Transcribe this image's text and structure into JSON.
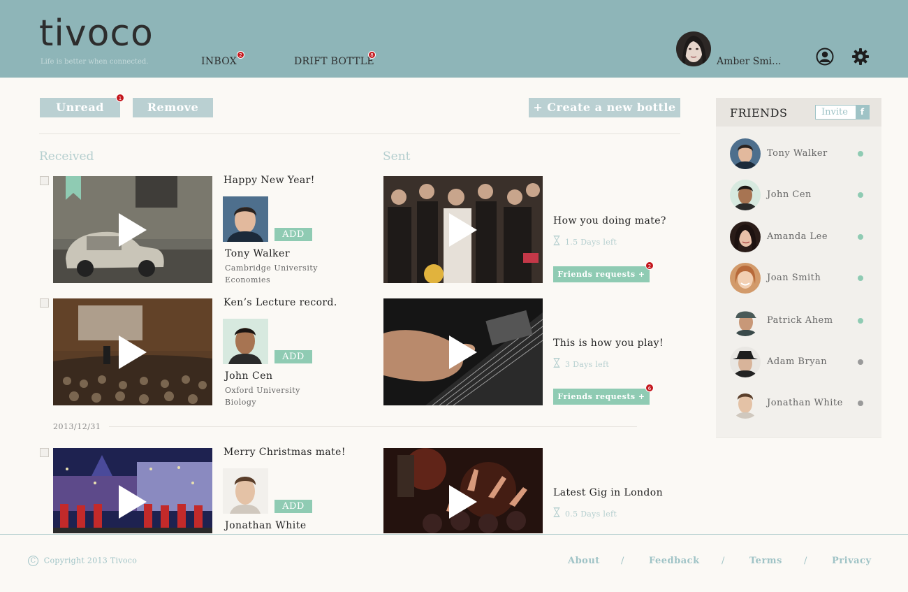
{
  "header": {
    "logo": "tivoco",
    "tagline": "Life is better when connected.",
    "nav": [
      {
        "label": "INBOX",
        "badge": "2"
      },
      {
        "label": "DRIFT BOTTLE",
        "badge": "8"
      }
    ],
    "user_name": "Amber Smi..."
  },
  "toolbar": {
    "unread_label": "Unread",
    "unread_badge": "1",
    "remove_label": "Remove",
    "create_label": "+ Create a new bottle"
  },
  "columns": {
    "received": "Received",
    "sent": "Sent"
  },
  "received": [
    {
      "title": "Happy New Year!",
      "name": "Tony Walker",
      "school": "Cambridge University",
      "major": "Economies",
      "add": "ADD"
    },
    {
      "title": "Ken’s Lecture record.",
      "name": "John Cen",
      "school": "Oxford University",
      "major": "Biology",
      "add": "ADD"
    },
    {
      "title": "Merry Christmas mate!",
      "name": "Jonathan White",
      "add": "ADD"
    }
  ],
  "sent": [
    {
      "title": "How you doing mate?",
      "days": "1.5 Days left",
      "button": "Friends requests +",
      "badge": "2"
    },
    {
      "title": "This is how you play!",
      "days": "3 Days left",
      "button": "Friends requests +",
      "badge": "6"
    },
    {
      "title": "Latest Gig in London",
      "days": "0.5 Days left"
    }
  ],
  "date_separator": "2013/12/31",
  "friends": {
    "title": "FRIENDS",
    "invite": "Invite",
    "fb": "f",
    "list": [
      {
        "name": "Tony Walker",
        "status_color": "#8fcbb3"
      },
      {
        "name": "John Cen",
        "status_color": "#8fcbb3"
      },
      {
        "name": "Amanda Lee",
        "status_color": "#8fcbb3"
      },
      {
        "name": "Joan Smith",
        "status_color": "#8fcbb3"
      },
      {
        "name": "Patrick Ahem",
        "status_color": "#8fcbb3"
      },
      {
        "name": "Adam Bryan",
        "status_color": "#9a9a9a"
      },
      {
        "name": "Jonathan White",
        "status_color": "#9a9a9a"
      }
    ]
  },
  "footer": {
    "copyright_symbol": "C",
    "copyright": "Copyright 2013 Tivoco",
    "links": [
      "About",
      "Feedback",
      "Terms",
      "Privacy"
    ],
    "separator": "/"
  }
}
